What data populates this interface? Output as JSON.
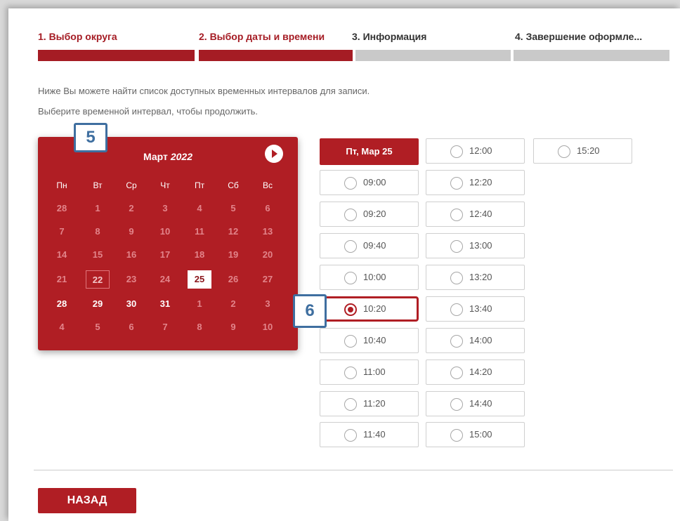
{
  "steps": [
    {
      "label": "1. Выбор округа",
      "state": "done"
    },
    {
      "label": "2. Выбор даты и времени",
      "state": "done"
    },
    {
      "label": "3. Информация",
      "state": "todo"
    },
    {
      "label": "4. Завершение оформле...",
      "state": "todo"
    }
  ],
  "intro": {
    "line1": "Ниже Вы можете найти список доступных временных интервалов для записи.",
    "line2": "Выберите временной интервал, чтобы продолжить."
  },
  "calendar": {
    "month": "Март",
    "year": "2022",
    "next_icon": "chevron-right-circle-icon",
    "weekdays": [
      "Пн",
      "Вт",
      "Ср",
      "Чт",
      "Пт",
      "Сб",
      "Вс"
    ],
    "weeks": [
      [
        "28",
        "1",
        "2",
        "3",
        "4",
        "5",
        "6"
      ],
      [
        "7",
        "8",
        "9",
        "10",
        "11",
        "12",
        "13"
      ],
      [
        "14",
        "15",
        "16",
        "17",
        "18",
        "19",
        "20"
      ],
      [
        "21",
        "22",
        "23",
        "24",
        "25",
        "26",
        "27"
      ],
      [
        "28",
        "29",
        "30",
        "31",
        "1",
        "2",
        "3"
      ],
      [
        "4",
        "5",
        "6",
        "7",
        "8",
        "9",
        "10"
      ]
    ],
    "today": "22",
    "selected": "25"
  },
  "slots": {
    "date_header": "Пт, Мар 25",
    "column1": [
      "09:00",
      "09:20",
      "09:40",
      "10:00",
      "10:20",
      "10:40",
      "11:00",
      "11:20",
      "11:40"
    ],
    "column2": [
      "12:00",
      "12:20",
      "12:40",
      "13:00",
      "13:20",
      "13:40",
      "14:00",
      "14:20",
      "14:40",
      "15:00"
    ],
    "column3": [
      "15:20"
    ],
    "selected": "10:20"
  },
  "annotations": {
    "badge_calendar": "5",
    "badge_slot": "6",
    "color": "#3f6fa0"
  },
  "colors": {
    "accent": "#b01e24",
    "step_inactive": "#c9c9c9"
  },
  "footer": {
    "back_label": "НАЗАД"
  }
}
